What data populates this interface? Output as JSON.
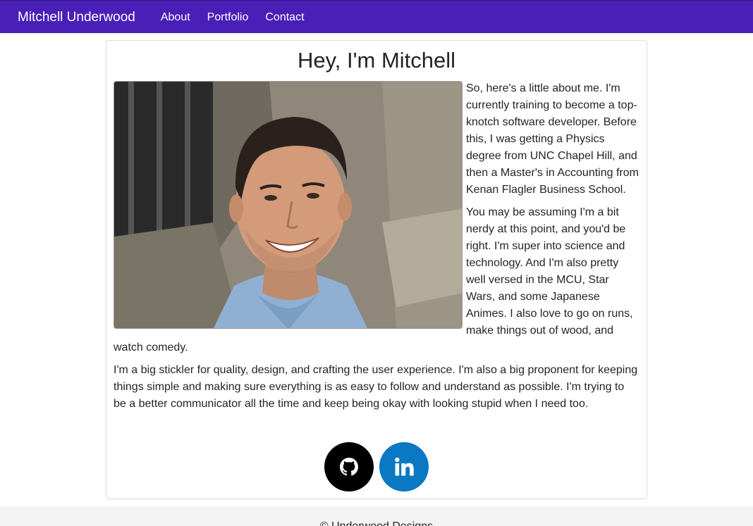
{
  "navbar": {
    "brand": "Mitchell Underwood",
    "links": [
      "About",
      "Portfolio",
      "Contact"
    ],
    "background": "#4a1fb8"
  },
  "main": {
    "heading": "Hey, I'm Mitchell",
    "photo": {
      "alt_icon": "profile-photo"
    },
    "paragraphs": [
      "So, here's a little about me. I'm currently training to become a top-knotch software developer. Before this, I was getting a Physics degree from UNC Chapel Hill, and then a Master's in Accounting from Kenan Flagler Business School.",
      "You may be assuming I'm a bit nerdy at this point, and you'd be right. I'm super into science and technology. And I'm also pretty well versed in the MCU, Star Wars, and some Japanese Animes. I also love to go on runs, make things out of wood, and watch comedy.",
      "I'm a big stickler for quality, design, and crafting the user experience. I'm also a big proponent for keeping things simple and making sure everything is as easy to follow and understand as possible. I'm trying to be a better communicator all the time and keep being okay with looking stupid when I need too."
    ],
    "social": [
      {
        "icon": "github-icon",
        "color": "#000000"
      },
      {
        "icon": "linkedin-icon",
        "color": "#0a78c2"
      }
    ]
  },
  "footer": {
    "text": "© Underwood Designs"
  }
}
